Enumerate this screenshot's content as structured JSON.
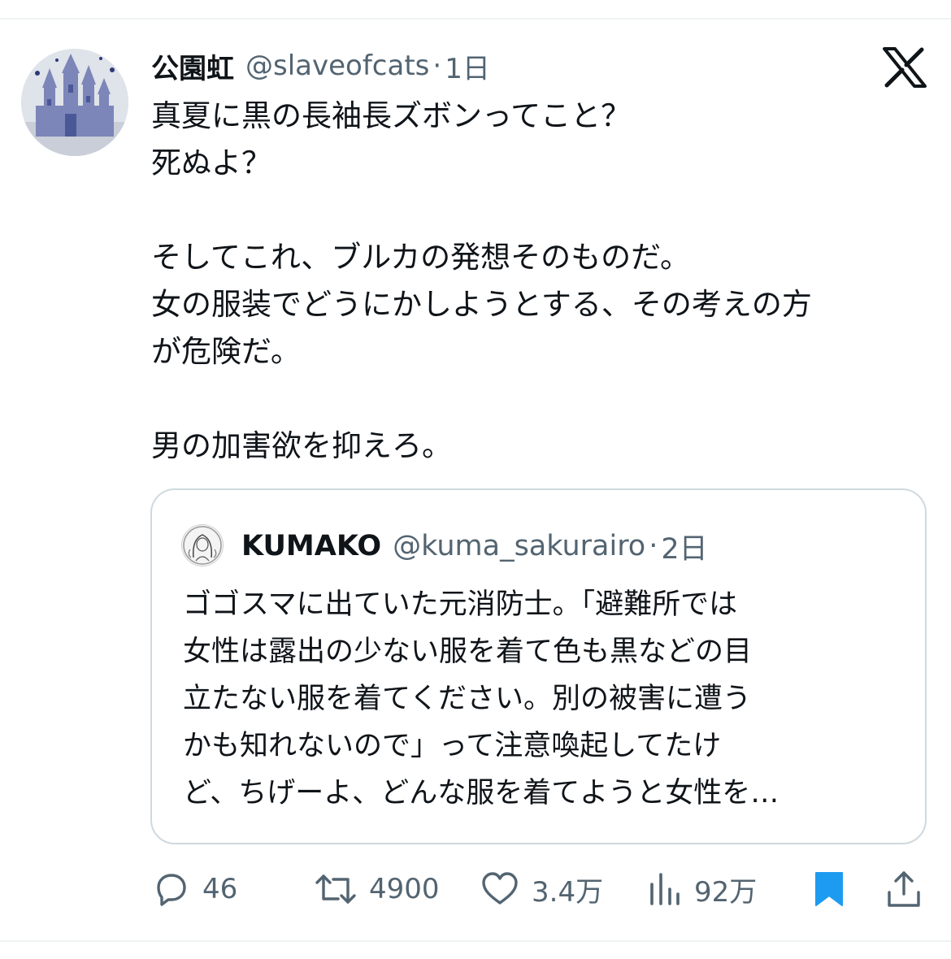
{
  "tweet": {
    "author_name": "公園虹",
    "handle": "@slaveofcats",
    "separator": "·",
    "time": "1日",
    "lines": [
      "真夏に黒の長袖長ズボンってこと？",
      "死ぬよ？",
      "",
      "そしてこれ、ブルカの発想そのものだ。",
      "女の服装でどうにかしようとする、その考えの方",
      "が危険だ。",
      "",
      "男の加害欲を抑えろ。"
    ]
  },
  "quote": {
    "author_name": "KUMAKO",
    "handle": "@kuma_sakurairo",
    "separator": "·",
    "time": "2日",
    "lines": [
      "ゴゴスマに出ていた元消防士。「避難所では",
      "女性は露出の少ない服を着て色も黒などの目",
      "立たない服を着てください。別の被害に遭う",
      "かも知れないので」って注意喚起してたけ",
      "ど、ちげーよ、どんな服を着てようと女性を…"
    ]
  },
  "actions": {
    "replies": "46",
    "retweets": "4900",
    "likes": "3.4万",
    "views": "92万"
  },
  "icons": {
    "logo": "x-logo-icon",
    "reply": "reply-icon",
    "retweet": "retweet-icon",
    "like": "heart-icon",
    "views": "views-chart-icon",
    "bookmark": "bookmark-icon",
    "share": "share-icon"
  },
  "colors": {
    "text": "#0f1419",
    "secondary": "#536471",
    "bookmark_active": "#1d9bf0",
    "border": "#cfd9de"
  }
}
